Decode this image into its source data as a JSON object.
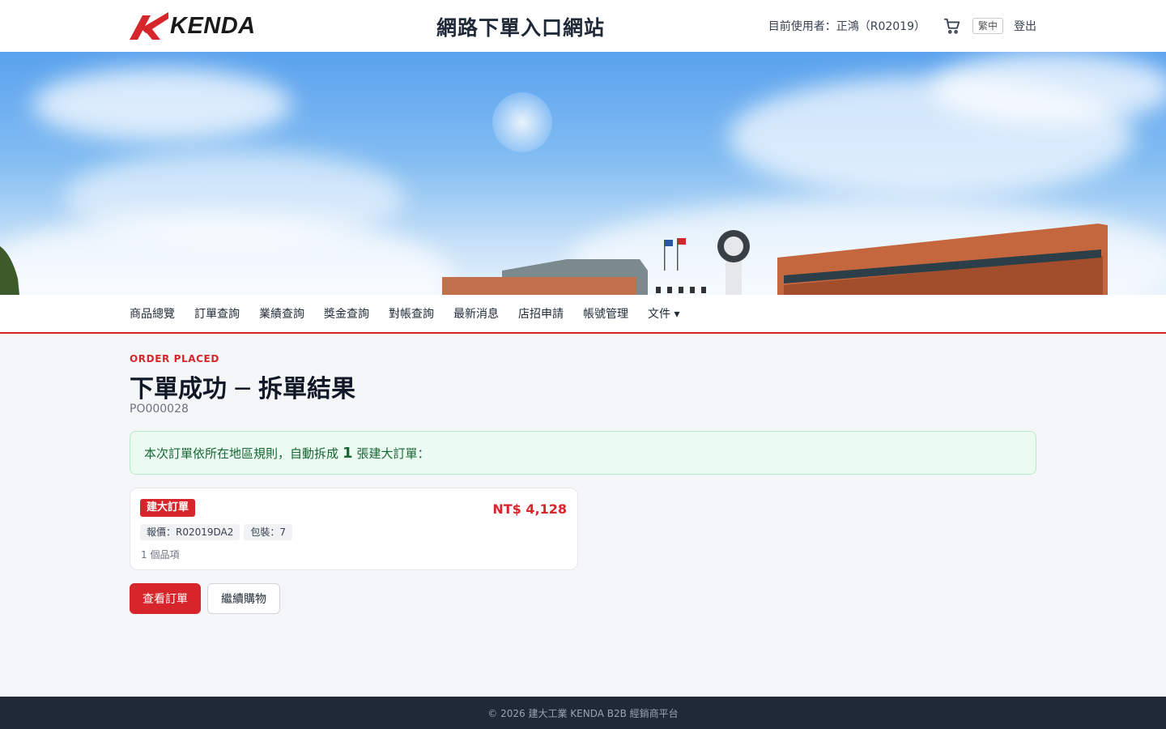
{
  "header": {
    "logo_text": "KENDA",
    "site_title": "網路下單入口網站",
    "user_label": "目前使用者：正鴻（R02019）",
    "lang": "繁中",
    "logout": "登出"
  },
  "nav": {
    "items": [
      {
        "label": "商品總覽"
      },
      {
        "label": "訂單查詢"
      },
      {
        "label": "業績查詢"
      },
      {
        "label": "獎金查詢"
      },
      {
        "label": "對帳查詢"
      },
      {
        "label": "最新消息"
      },
      {
        "label": "店招申請"
      },
      {
        "label": "帳號管理"
      },
      {
        "label": "文件 ▾"
      }
    ]
  },
  "main": {
    "eyebrow": "ORDER PLACED",
    "title": "下單成功 ─ 拆單結果",
    "po_number": "PO000028",
    "notice_prefix": "本次訂單依所在地區規則，自動拆成",
    "notice_count": "1",
    "notice_suffix": "張建大訂單：",
    "order_card": {
      "tag": "建大訂單",
      "amount": "NT$ 4,128",
      "quote_chip": "報價：R02019DA2",
      "pack_chip": "包裝：7",
      "item_count": "1 個品項"
    },
    "view_order_button": "查看訂單",
    "continue_button": "繼續購物"
  },
  "footer": {
    "text": "© 2026 建大工業 KENDA B2B 經銷商平台"
  },
  "colors": {
    "brand_red": "#d7262b",
    "success_bg": "#ecfbf1",
    "success_text": "#166534",
    "footer_bg": "#1f2937"
  }
}
